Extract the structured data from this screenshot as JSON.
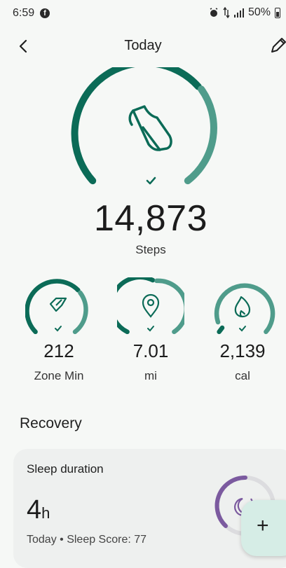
{
  "status_bar": {
    "time": "6:59",
    "battery": "50%"
  },
  "header": {
    "title": "Today"
  },
  "steps": {
    "value": "14,873",
    "label": "Steps",
    "progress": 0.97
  },
  "metrics": [
    {
      "value": "212",
      "label": "Zone Min",
      "progress": 0.97
    },
    {
      "value": "7.01",
      "label": "mi",
      "progress": 0.85
    },
    {
      "value": "2,139",
      "label": "cal",
      "progress": 0.95
    }
  ],
  "recovery": {
    "title": "Recovery",
    "sleep": {
      "title": "Sleep duration",
      "value": "4",
      "unit": "h",
      "subtitle": "Today • Sleep Score: 77",
      "progress": 0.5
    }
  },
  "colors": {
    "ring_dark": "#0b6b57",
    "ring_light": "#4f9c8b",
    "sleep_ring": "#7b5a9f",
    "fab_bg": "#d6ede6"
  },
  "icons": {
    "steps": "shoe-icon",
    "zone": "zone-minutes-icon",
    "distance": "location-pin-icon",
    "calories": "flame-icon",
    "sleep": "moon-stars-icon"
  }
}
